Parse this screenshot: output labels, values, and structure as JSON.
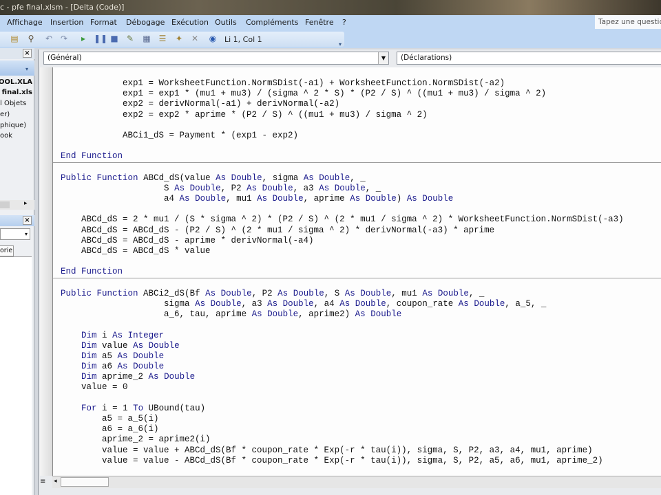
{
  "window": {
    "title": "c - pfe final.xlsm - [Delta (Code)]"
  },
  "menu": [
    "Affichage",
    "Insertion",
    "Format",
    "Débogage",
    "Exécution",
    "Outils",
    "Compléments",
    "Fenêtre",
    "?"
  ],
  "help_box": "Tapez une questio",
  "toolbar": {
    "position": "Li 1, Col 1",
    "icons": [
      "paste-icon",
      "find-icon",
      "undo-icon",
      "redo-icon",
      "run-icon",
      "pause-icon",
      "stop-icon",
      "design-mode-icon",
      "project-explorer-icon",
      "properties-icon",
      "object-browser-icon",
      "toolbox-icon",
      "help-icon"
    ]
  },
  "project_explorer": {
    "items": [
      "TOOL.XLA",
      "final.xls",
      "l Objets",
      "er)",
      "phique)",
      "ook"
    ]
  },
  "properties": {
    "tab": "orie"
  },
  "code_window": {
    "object_combo": "(Général)",
    "proc_combo": "(Déclarations)"
  },
  "code": [
    "            exp1 = WorksheetFunction.NormSDist(-a1) + WorksheetFunction.NormSDist(-a2)",
    "            exp1 = exp1 * (mu1 + mu3) / (sigma ^ 2 * S) * (P2 / S) ^ ((mu1 + mu3) / sigma ^ 2)",
    "            exp2 = derivNormal(-a1) + derivNormal(-a2)",
    "            exp2 = exp2 * aprime * (P2 / S) ^ ((mu1 + mu3) / sigma ^ 2)",
    "",
    "            ABCi1_dS = Payment * (exp1 - exp2)",
    "",
    "End Function",
    "---",
    "",
    "Public Function ABCd_dS(value As Double, sigma As Double, _",
    "                    S As Double, P2 As Double, a3 As Double, _",
    "                    a4 As Double, mu1 As Double, aprime As Double) As Double",
    "",
    "    ABCd_dS = 2 * mu1 / (S * sigma ^ 2) * (P2 / S) ^ (2 * mu1 / sigma ^ 2) * WorksheetFunction.NormSDist(-a3)",
    "    ABCd_dS = ABCd_dS - (P2 / S) ^ (2 * mu1 / sigma ^ 2) * derivNormal(-a3) * aprime",
    "    ABCd_dS = ABCd_dS - aprime * derivNormal(-a4)",
    "    ABCd_dS = ABCd_dS * value",
    "",
    "End Function",
    "---",
    "",
    "Public Function ABCi2_dS(Bf As Double, P2 As Double, S As Double, mu1 As Double, _",
    "                    sigma As Double, a3 As Double, a4 As Double, coupon_rate As Double, a_5, _",
    "                    a_6, tau, aprime As Double, aprime2) As Double",
    "",
    "    Dim i As Integer",
    "    Dim value As Double",
    "    Dim a5 As Double",
    "    Dim a6 As Double",
    "    Dim aprime_2 As Double",
    "    value = 0",
    "",
    "    For i = 1 To UBound(tau)",
    "        a5 = a_5(i)",
    "        a6 = a_6(i)",
    "        aprime_2 = aprime2(i)",
    "        value = value + ABCd_dS(Bf * coupon_rate * Exp(-r * tau(i)), sigma, S, P2, a3, a4, mu1, aprime)",
    "        value = value - ABCd_dS(Bf * coupon_rate * Exp(-r * tau(i)), sigma, S, P2, a5, a6, mu1, aprime_2)"
  ]
}
